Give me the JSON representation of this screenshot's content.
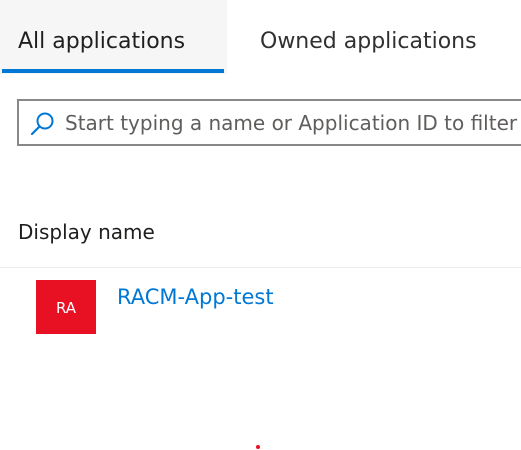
{
  "tabs": {
    "all_label": "All applications",
    "owned_label": "Owned applications",
    "active": "All applications"
  },
  "search": {
    "placeholder": "Start typing a name or Application ID to filter these results"
  },
  "table": {
    "columns": [
      "Display name"
    ],
    "rows": [
      {
        "avatar_initials": "RA",
        "avatar_color": "#e81123",
        "display_name": "RACM-App-test"
      }
    ]
  },
  "colors": {
    "accent": "#0078d4",
    "link": "#0078d4",
    "avatar": "#e81123"
  },
  "icons": {
    "search": "search-icon"
  }
}
